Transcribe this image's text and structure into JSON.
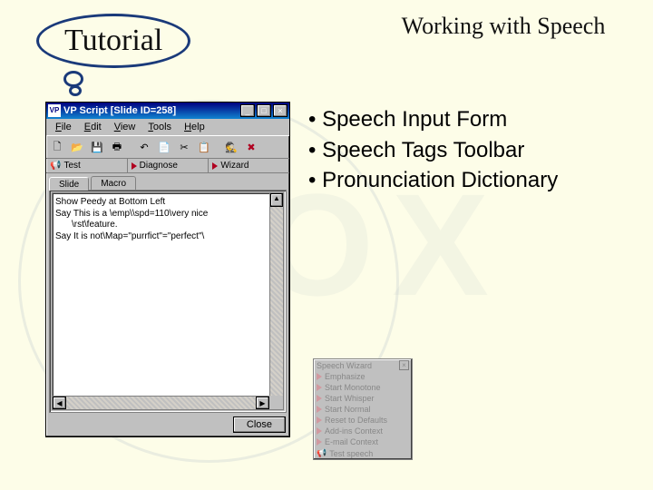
{
  "bubble": {
    "label": "Tutorial"
  },
  "heading": "Working with Speech",
  "bullets": [
    "Speech Input Form",
    "Speech Tags Toolbar",
    "Pronunciation Dictionary"
  ],
  "window": {
    "appicon": "VP",
    "title": "VP Script [Slide ID=258]",
    "controls": {
      "min": "_",
      "max": "□",
      "close": "×"
    },
    "menus": [
      "File",
      "Edit",
      "View",
      "Tools",
      "Help"
    ],
    "toolbar_icons": [
      "new",
      "open",
      "save",
      "print",
      "undo",
      "copy",
      "cut",
      "paste",
      "agent",
      "delete-agent"
    ],
    "action_buttons": [
      "Test",
      "Diagnose",
      "Wizard"
    ],
    "tabs": {
      "items": [
        "Slide",
        "Macro"
      ],
      "active": 0
    },
    "script_lines": [
      "Show Peedy at Bottom Left",
      "Say This is a \\emp\\\\spd=110\\very nice",
      "\\rst\\feature.",
      "Say It is not\\Map=\"purrfict\"=\"perfect\"\\"
    ],
    "close_label": "Close"
  },
  "wizard": {
    "title": "Speech Wizard",
    "items": [
      "Emphasize",
      "Start Monotone",
      "Start Whisper",
      "Start Normal",
      "Reset to Defaults",
      "Add-ins Context",
      "E-mail Context",
      "Test speech"
    ]
  }
}
